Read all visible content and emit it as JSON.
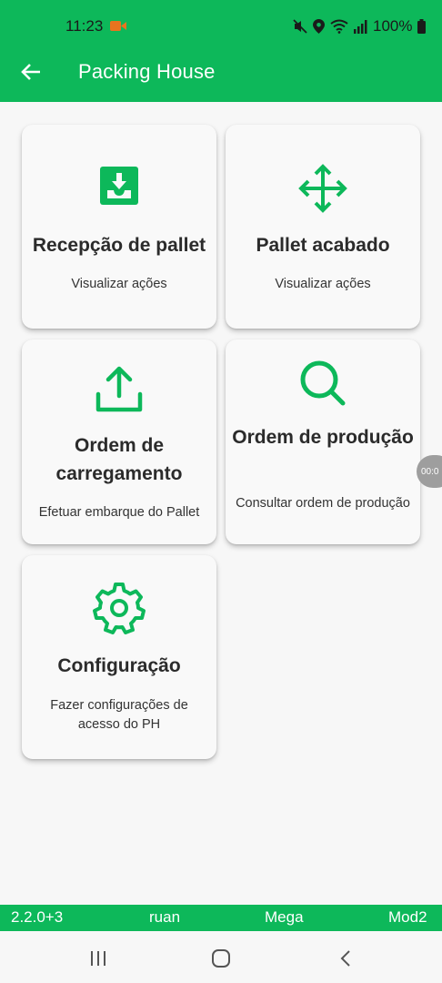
{
  "status_bar": {
    "time": "11:23",
    "battery": "100%"
  },
  "app_bar": {
    "title": "Packing House"
  },
  "cards": [
    {
      "title": "Recepção de pallet",
      "subtitle": "Visualizar ações",
      "icon": "inbox-download-icon"
    },
    {
      "title": "Pallet acabado",
      "subtitle": "Visualizar ações",
      "icon": "move-arrows-icon"
    },
    {
      "title": "Ordem de carregamento",
      "subtitle": "Efetuar embarque do Pallet",
      "icon": "upload-icon"
    },
    {
      "title": "Ordem de produção",
      "subtitle": "Consultar ordem de produção",
      "icon": "search-icon"
    },
    {
      "title": "Configuração",
      "subtitle": "Fazer configurações de acesso do PH",
      "icon": "gear-icon"
    }
  ],
  "side_pill": {
    "text": "00:0"
  },
  "footer": {
    "version": "2.2.0+3",
    "user": "ruan",
    "company": "Mega",
    "module": "Mod2"
  },
  "colors": {
    "accent": "#0db85a",
    "background": "#f7f7f7"
  }
}
